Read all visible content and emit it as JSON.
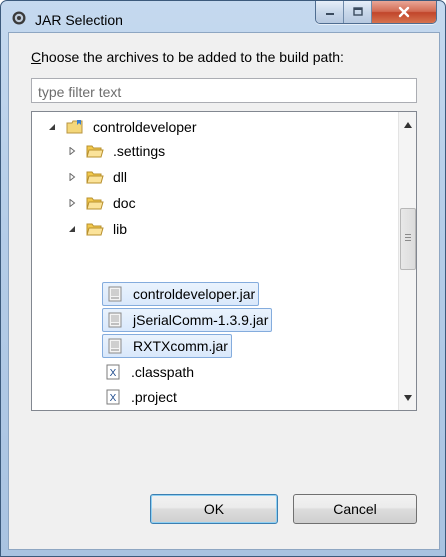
{
  "window": {
    "title": "JAR Selection",
    "controls": {
      "minimize": "minimize",
      "maximize": "maximize",
      "close": "close"
    }
  },
  "dialog": {
    "prompt_accel": "C",
    "prompt_rest": "hoose the archives to be added to the build path:",
    "filter_placeholder": "type filter text"
  },
  "tree": {
    "project": "controldeveloper",
    "folders": [
      ".settings",
      "dll",
      "doc"
    ],
    "lib_folder": "lib",
    "jars": [
      "controldeveloper.jar",
      "jSerialComm-1.3.9.jar",
      "RXTXcomm.jar"
    ],
    "files": [
      ".classpath",
      ".project"
    ],
    "file_icon_letter": "X"
  },
  "buttons": {
    "ok": "OK",
    "cancel": "Cancel"
  },
  "colors": {
    "selection_border": "#84acdd",
    "selection_fill": "#d9e8fb",
    "folder": "#f2c94c",
    "close_button": "#c1452b"
  }
}
